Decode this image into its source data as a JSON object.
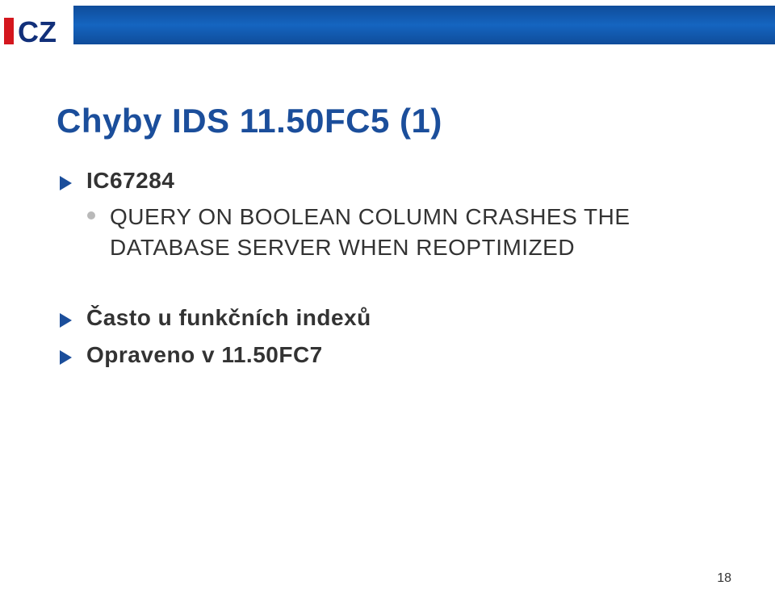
{
  "logo": {
    "text_i": "I",
    "text_cz": "CZ",
    "red": "#d4171e",
    "blue": "#12307a"
  },
  "header_bar_color": "#1056a8",
  "title": "Chyby IDS 11.50FC5 (1)",
  "bullets": [
    {
      "label": "IC67284",
      "sub": "QUERY ON BOOLEAN COLUMN CRASHES THE DATABASE SERVER WHEN REOPTIMIZED"
    },
    {
      "label": "Často u funkčních indexů"
    },
    {
      "label": "Opraveno v 11.50FC7"
    }
  ],
  "page_number": "18"
}
